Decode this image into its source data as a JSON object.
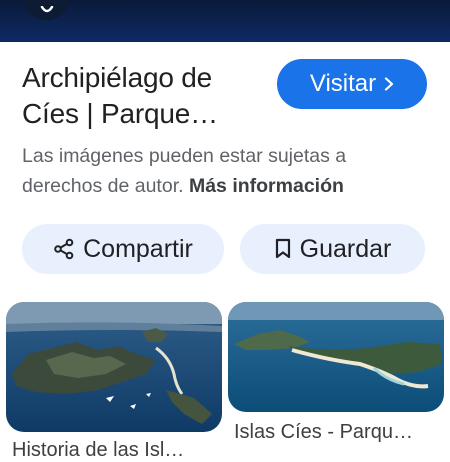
{
  "result": {
    "title": "Archipiélago de Cíes | Parque…",
    "visit_label": "Visitar",
    "notice_text": "Las imágenes pueden estar sujetas a derechos de autor.",
    "more_info_label": "Más información"
  },
  "actions": {
    "share_label": "Compartir",
    "save_label": "Guardar"
  },
  "related": [
    {
      "caption": "Historia de las Isl…"
    },
    {
      "caption": "Islas Cíes - Parqu…"
    }
  ],
  "colors": {
    "accent": "#1a73e8",
    "pill_bg": "#e8f0fe",
    "header_bg": "#0c2250"
  },
  "icons": {
    "visit": "chevron-right-icon",
    "share": "share-icon",
    "save": "bookmark-icon"
  }
}
